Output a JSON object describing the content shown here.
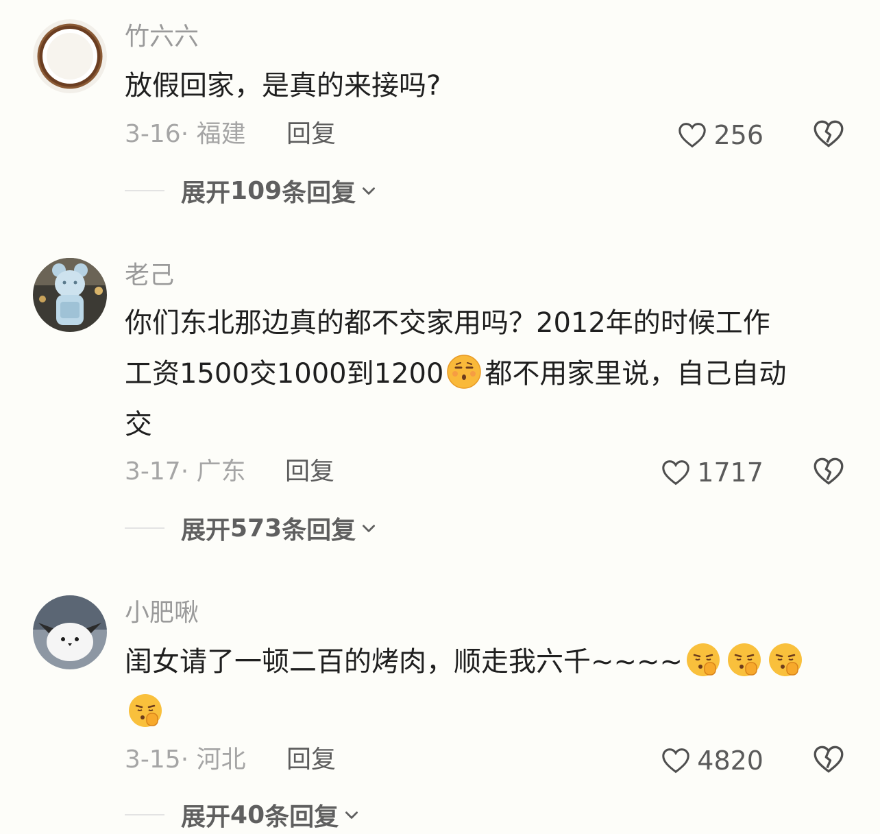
{
  "comments": [
    {
      "username": "竹六六",
      "avatar": "coconut-avatar",
      "lines": [
        "放假回家，是真的来接吗?"
      ],
      "date_location": "3-16· 福建",
      "reply_label": "回复",
      "likes": "256",
      "expand": {
        "prefix": "展开 ",
        "count": "109",
        "suffix": " 条回复"
      }
    },
    {
      "username": "老己",
      "avatar": "ice-bear-avatar",
      "line1": "你们东北那边真的都不交家用吗？2012年的时候工作",
      "line2_a": "工资1500交1000到1200",
      "line2_b": "都不用家里说，自己自动",
      "line3": "交",
      "date_location": "3-17· 广东",
      "reply_label": "回复",
      "likes": "1717",
      "expand": {
        "prefix": "展开 ",
        "count": "573",
        "suffix": " 条回复"
      }
    },
    {
      "username": "小肥啾",
      "avatar": "white-bird-avatar",
      "line1": "闺女请了一顿二百的烤肉，顺走我六千~~~~",
      "date_location": "3-15· 河北",
      "reply_label": "回复",
      "likes": "4820",
      "expand": {
        "prefix": "展开 ",
        "count": "40",
        "suffix": " 条回复"
      }
    }
  ],
  "icons": {
    "like": "heart-outline-icon",
    "dislike": "broken-heart-icon",
    "expand": "chevron-down-icon",
    "emoji_smug": "smirk-emoji",
    "emoji_shush": "shush-emoji"
  },
  "colors": {
    "background": "#fdfdf9",
    "username": "#9a9a9a",
    "meta": "#a5a5a5",
    "body": "#1f1f1f"
  }
}
